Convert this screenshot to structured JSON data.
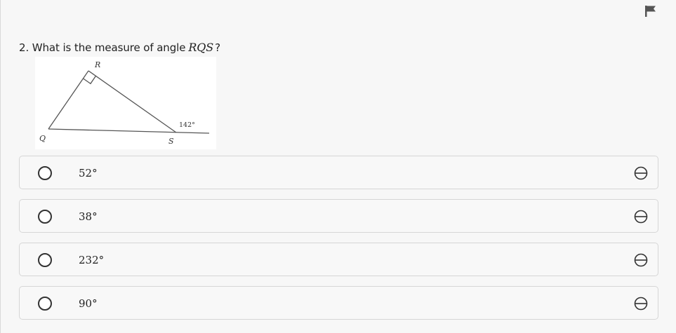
{
  "question": {
    "prefix": "2. What is the measure of angle",
    "angle_name": "RQS",
    "suffix": "?"
  },
  "figure": {
    "vertex_r": "R",
    "vertex_q": "Q",
    "vertex_s": "S",
    "exterior_angle": "142°"
  },
  "options": [
    {
      "label": "52°"
    },
    {
      "label": "38°"
    },
    {
      "label": "232°"
    },
    {
      "label": "90°"
    }
  ],
  "icons": {
    "flag": "flag-icon",
    "radio": "radio-button-icon",
    "eliminate": "eliminate-option-icon"
  },
  "colors": {
    "background": "#f7f7f7",
    "option_border": "#d6d6d6",
    "flag": "#555555"
  }
}
